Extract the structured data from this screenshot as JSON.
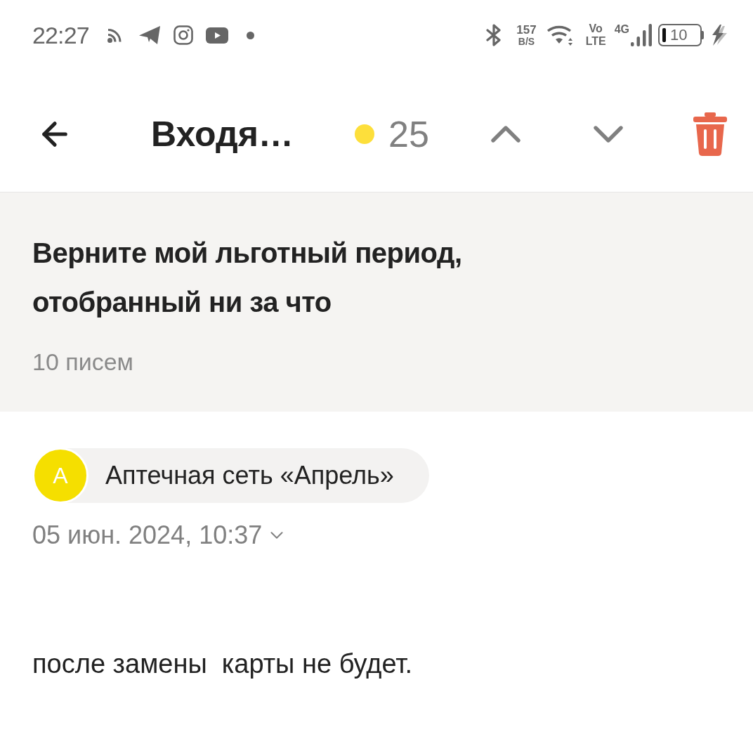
{
  "status_bar": {
    "time": "22:27",
    "network_speed": {
      "value": "157",
      "unit": "B/S"
    },
    "volte": {
      "line_1": "Vo",
      "line_2": "LTE"
    },
    "network_type": "4G",
    "battery": "10"
  },
  "header": {
    "folder_title": "Входя…",
    "unread_count": "25"
  },
  "thread": {
    "subject": "Верните мой льготный период, отобранный ни за что",
    "message_count": "10 писем"
  },
  "message": {
    "sender": {
      "initial": "А",
      "name": "Аптечная сеть «Апрель»"
    },
    "date": "05 июн. 2024, 10:37",
    "body": "после замены  карты не будет."
  }
}
